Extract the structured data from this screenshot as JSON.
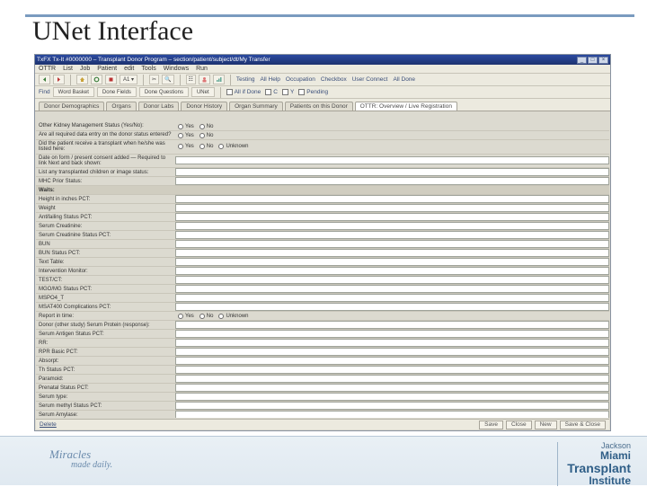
{
  "slide": {
    "title": "UNet Interface"
  },
  "footer": {
    "tagline": "Miracles",
    "sub": "made daily.",
    "logo1": "Miami",
    "logo2": "Transplant",
    "logo3": "Institute",
    "brand": "Jackson"
  },
  "app": {
    "title": "TxFX Tx-It #0000000 – Transplant Donor Program – section/patient/subject/dt/My Transfer",
    "winbtns": {
      "min": "_",
      "max": "□",
      "close": "×"
    },
    "menu": [
      "OTTR",
      "List",
      "Job",
      "Patient",
      "edit",
      "Tools",
      "Windows",
      "Run"
    ],
    "toolbar1_labels": [
      "Back",
      "Fwd"
    ],
    "toolbar2": {
      "find": "Find",
      "btns": [
        "Word Basket",
        "Done Fields",
        "Done Questions",
        "UNet"
      ],
      "toggles": [
        "All if Done",
        "C",
        "Y",
        "Pending"
      ]
    },
    "toolbar_links": [
      "Testing",
      "All Help",
      "Occupation",
      "Checkbox",
      "User Connect",
      "All Done"
    ],
    "tabs": [
      "Donor Demographics",
      "Organs",
      "Donor Labs",
      "Donor History",
      "Organ Summary",
      "Patients on this Donor",
      "OTTR: Overview / Live Registration"
    ],
    "active_tab": 6,
    "status": {
      "left": "Delete",
      "buttons": [
        "Save",
        "Close",
        "New",
        "Save & Close"
      ]
    },
    "fields": [
      {
        "label": "Other Kidney Management Status (Yes/No):",
        "type": "radio",
        "options": [
          "Yes",
          "No"
        ]
      },
      {
        "label": "Are all required data entry on the donor status entered?",
        "type": "radio",
        "options": [
          "Yes",
          "No"
        ]
      },
      {
        "label": "Did the patient receive a transplant when he/she was listed here:",
        "type": "radio",
        "options": [
          "Yes",
          "No",
          "Unknown"
        ]
      },
      {
        "label": "Date on form / present consent added — Required to link Next and back shown:",
        "type": "text"
      },
      {
        "label": "List any transplanted children or image status:",
        "type": "text"
      },
      {
        "label": "MHC Prior Status:",
        "type": "text"
      },
      {
        "label": "Waits:",
        "type": "section"
      },
      {
        "label": "Height in inches PCT:",
        "type": "text"
      },
      {
        "label": "Weight",
        "type": "text"
      },
      {
        "label": "Antifailing Status PCT:",
        "type": "text"
      },
      {
        "label": "Serum Creatinine:",
        "type": "text"
      },
      {
        "label": "Serum Creatinine Status PCT:",
        "type": "text"
      },
      {
        "label": "BUN",
        "type": "text"
      },
      {
        "label": "BUN Status PCT:",
        "type": "text"
      },
      {
        "label": "Text Table:",
        "type": "text"
      },
      {
        "label": "Intervention Monitor:",
        "type": "text"
      },
      {
        "label": "TEST/CT:",
        "type": "text"
      },
      {
        "label": "MGO/MG Status PCT:",
        "type": "text"
      },
      {
        "label": "MSPO4_T",
        "type": "text"
      },
      {
        "label": "MSAT400 Complications PCT:",
        "type": "text"
      },
      {
        "label": "Report in time:",
        "type": "radio",
        "options": [
          "Yes",
          "No",
          "Unknown"
        ]
      },
      {
        "label": "Donor (other study) Serum Protein (response):",
        "type": "text"
      },
      {
        "label": "Serum Antigen Status PCT:",
        "type": "text"
      },
      {
        "label": "RR:",
        "type": "text"
      },
      {
        "label": "RPR Basic PCT:",
        "type": "text"
      },
      {
        "label": "Absorpt:",
        "type": "text"
      },
      {
        "label": "Th Status PCT:",
        "type": "text"
      },
      {
        "label": "Paramoid:",
        "type": "text"
      },
      {
        "label": "Prenatal Status PCT:",
        "type": "text"
      },
      {
        "label": "Serum type:",
        "type": "text"
      },
      {
        "label": "Serum methyl Status PCT:",
        "type": "text"
      },
      {
        "label": "Serum Amylase:",
        "type": "text"
      }
    ]
  }
}
